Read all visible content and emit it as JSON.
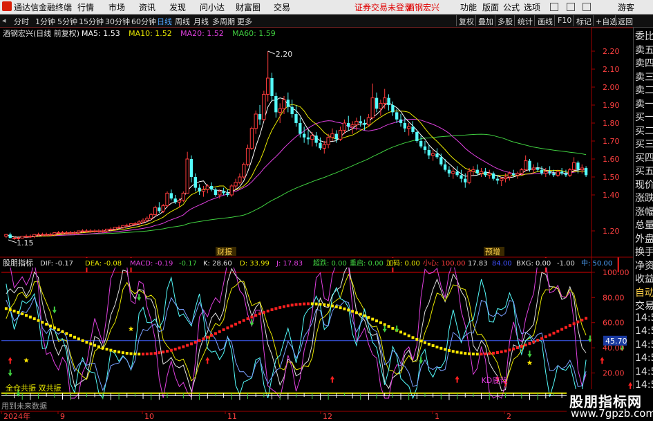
{
  "titlebar": {
    "app_name": "通达信金融终端",
    "menus": [
      "行情",
      "市场",
      "资讯",
      "发现",
      "问小达",
      "财富圈",
      "交易"
    ],
    "warning": "证券交易未登录",
    "stock_tag": "酒钢宏兴",
    "right_menus": [
      "功能",
      "版面",
      "公式",
      "选项"
    ],
    "guest": "游客"
  },
  "toolbar": {
    "periods": [
      "分时",
      "1分钟",
      "5分钟",
      "15分钟",
      "30分钟",
      "60分钟",
      "日线",
      "周线",
      "月线",
      "多周期",
      "更多"
    ],
    "active_period": "日线",
    "right_buttons": [
      "复权",
      "叠加",
      "多股",
      "统计",
      "画线",
      "F10",
      "标记",
      "+自选",
      "返回"
    ]
  },
  "right_panel": {
    "items": [
      "委比",
      "卖五",
      "卖四",
      "卖三",
      "卖二",
      "卖一",
      "买一",
      "买二",
      "买三",
      "买四",
      "买五",
      "现价",
      "涨跌",
      "涨幅",
      "总量",
      "外盘",
      "换手",
      "净资",
      "收益",
      "自动",
      "交易",
      "14:5",
      "14:5",
      "14:5",
      "14:5",
      "14:5",
      "14:5",
      "14:5",
      "14:5"
    ]
  },
  "watermark": {
    "name": "股朋指标网",
    "url": "www.7gpzb.com"
  },
  "chart_data": [
    {
      "type": "candlestick",
      "stock": "酒钢宏兴(日线 前复权)",
      "legend": [
        {
          "name": "MA5",
          "value": "1.53",
          "color": "#ffffff"
        },
        {
          "name": "MA10",
          "value": "1.52",
          "color": "#e8e800"
        },
        {
          "name": "MA20",
          "value": "1.52",
          "color": "#e040e0"
        },
        {
          "name": "MA60",
          "value": "1.59",
          "color": "#40d040"
        }
      ],
      "ylim": [
        1.1,
        2.3
      ],
      "y_ticks": [
        "2.20",
        "2.10",
        "2.00",
        "1.90",
        "1.80",
        "1.70",
        "1.60",
        "1.50",
        "1.40",
        "1.20"
      ],
      "x_labels": [
        "2024年",
        "9",
        "10",
        "11",
        "12",
        "1",
        "2"
      ],
      "annotations": [
        "2.20",
        "1.15",
        "财报",
        "预增"
      ],
      "colors": {
        "up": "#ff3c3c",
        "down": "#54fcfc",
        "ma5": "#ffffff",
        "ma10": "#e8e800",
        "ma20": "#e040e0",
        "ma60": "#40d040"
      },
      "candles": [
        [
          1.17,
          1.18,
          1.16,
          1.18
        ],
        [
          1.18,
          1.19,
          1.16,
          1.16
        ],
        [
          1.16,
          1.17,
          1.15,
          1.16
        ],
        [
          1.16,
          1.17,
          1.15,
          1.16
        ],
        [
          1.16,
          1.17,
          1.16,
          1.17
        ],
        [
          1.17,
          1.18,
          1.16,
          1.17
        ],
        [
          1.17,
          1.18,
          1.16,
          1.17
        ],
        [
          1.17,
          1.18,
          1.16,
          1.18
        ],
        [
          1.18,
          1.19,
          1.17,
          1.18
        ],
        [
          1.18,
          1.19,
          1.17,
          1.18
        ],
        [
          1.18,
          1.19,
          1.17,
          1.18
        ],
        [
          1.18,
          1.19,
          1.17,
          1.18
        ],
        [
          1.18,
          1.19,
          1.17,
          1.19
        ],
        [
          1.19,
          1.2,
          1.18,
          1.19
        ],
        [
          1.19,
          1.2,
          1.18,
          1.19
        ],
        [
          1.19,
          1.2,
          1.18,
          1.19
        ],
        [
          1.19,
          1.2,
          1.18,
          1.19
        ],
        [
          1.19,
          1.2,
          1.18,
          1.19
        ],
        [
          1.19,
          1.2,
          1.18,
          1.2
        ],
        [
          1.2,
          1.21,
          1.19,
          1.2
        ],
        [
          1.2,
          1.21,
          1.19,
          1.2
        ],
        [
          1.2,
          1.21,
          1.19,
          1.2
        ],
        [
          1.2,
          1.21,
          1.19,
          1.2
        ],
        [
          1.2,
          1.21,
          1.19,
          1.2
        ],
        [
          1.2,
          1.21,
          1.19,
          1.2
        ],
        [
          1.2,
          1.21,
          1.19,
          1.21
        ],
        [
          1.21,
          1.22,
          1.2,
          1.21
        ],
        [
          1.21,
          1.22,
          1.2,
          1.22
        ],
        [
          1.22,
          1.23,
          1.21,
          1.22
        ],
        [
          1.22,
          1.23,
          1.21,
          1.23
        ],
        [
          1.23,
          1.24,
          1.22,
          1.23
        ],
        [
          1.23,
          1.24,
          1.22,
          1.24
        ],
        [
          1.24,
          1.25,
          1.23,
          1.24
        ],
        [
          1.24,
          1.26,
          1.23,
          1.25
        ],
        [
          1.25,
          1.27,
          1.24,
          1.26
        ],
        [
          1.26,
          1.28,
          1.25,
          1.27
        ],
        [
          1.27,
          1.3,
          1.26,
          1.29
        ],
        [
          1.29,
          1.34,
          1.28,
          1.33
        ],
        [
          1.33,
          1.36,
          1.3,
          1.31
        ],
        [
          1.31,
          1.35,
          1.3,
          1.34
        ],
        [
          1.34,
          1.42,
          1.33,
          1.41
        ],
        [
          1.41,
          1.43,
          1.37,
          1.38
        ],
        [
          1.38,
          1.4,
          1.35,
          1.36
        ],
        [
          1.36,
          1.38,
          1.33,
          1.37
        ],
        [
          1.37,
          1.42,
          1.36,
          1.41
        ],
        [
          1.41,
          1.64,
          1.41,
          1.6
        ],
        [
          1.6,
          1.62,
          1.47,
          1.5
        ],
        [
          1.5,
          1.52,
          1.42,
          1.44
        ],
        [
          1.44,
          1.46,
          1.4,
          1.42
        ],
        [
          1.42,
          1.45,
          1.39,
          1.43
        ],
        [
          1.43,
          1.46,
          1.41,
          1.45
        ],
        [
          1.45,
          1.47,
          1.42,
          1.43
        ],
        [
          1.43,
          1.44,
          1.39,
          1.4
        ],
        [
          1.4,
          1.43,
          1.38,
          1.42
        ],
        [
          1.42,
          1.44,
          1.4,
          1.41
        ],
        [
          1.41,
          1.43,
          1.39,
          1.4
        ],
        [
          1.4,
          1.46,
          1.39,
          1.45
        ],
        [
          1.45,
          1.49,
          1.43,
          1.47
        ],
        [
          1.47,
          1.52,
          1.46,
          1.5
        ],
        [
          1.5,
          1.58,
          1.49,
          1.57
        ],
        [
          1.57,
          1.68,
          1.56,
          1.66
        ],
        [
          1.66,
          1.78,
          1.65,
          1.77
        ],
        [
          1.77,
          1.87,
          1.74,
          1.85
        ],
        [
          1.85,
          1.9,
          1.79,
          1.82
        ],
        [
          1.82,
          1.98,
          1.81,
          1.96
        ],
        [
          1.96,
          2.2,
          1.92,
          2.05
        ],
        [
          2.05,
          2.08,
          1.92,
          1.95
        ],
        [
          1.95,
          1.97,
          1.83,
          1.86
        ],
        [
          1.86,
          1.91,
          1.8,
          1.88
        ],
        [
          1.88,
          1.95,
          1.85,
          1.93
        ],
        [
          1.93,
          1.97,
          1.86,
          1.89
        ],
        [
          1.89,
          1.93,
          1.83,
          1.85
        ],
        [
          1.85,
          1.9,
          1.78,
          1.8
        ],
        [
          1.8,
          1.83,
          1.72,
          1.74
        ],
        [
          1.74,
          1.78,
          1.69,
          1.72
        ],
        [
          1.72,
          1.76,
          1.68,
          1.71
        ],
        [
          1.71,
          1.75,
          1.67,
          1.73
        ],
        [
          1.73,
          1.75,
          1.67,
          1.69
        ],
        [
          1.69,
          1.72,
          1.65,
          1.66
        ],
        [
          1.66,
          1.7,
          1.63,
          1.68
        ],
        [
          1.68,
          1.74,
          1.66,
          1.72
        ],
        [
          1.72,
          1.77,
          1.7,
          1.74
        ],
        [
          1.74,
          1.76,
          1.69,
          1.71
        ],
        [
          1.71,
          1.78,
          1.7,
          1.76
        ],
        [
          1.76,
          1.82,
          1.74,
          1.8
        ],
        [
          1.8,
          1.84,
          1.76,
          1.78
        ],
        [
          1.78,
          1.81,
          1.74,
          1.79
        ],
        [
          1.79,
          1.83,
          1.76,
          1.81
        ],
        [
          1.81,
          1.84,
          1.78,
          1.8
        ],
        [
          1.8,
          1.82,
          1.76,
          1.79
        ],
        [
          1.79,
          1.85,
          1.78,
          1.83
        ],
        [
          1.83,
          2.02,
          1.82,
          1.94
        ],
        [
          1.94,
          1.97,
          1.86,
          1.88
        ],
        [
          1.88,
          1.93,
          1.84,
          1.91
        ],
        [
          1.91,
          1.99,
          1.88,
          1.94
        ],
        [
          1.94,
          1.96,
          1.87,
          1.9
        ],
        [
          1.9,
          1.92,
          1.84,
          1.86
        ],
        [
          1.86,
          1.88,
          1.8,
          1.82
        ],
        [
          1.82,
          1.85,
          1.78,
          1.8
        ],
        [
          1.8,
          1.83,
          1.75,
          1.77
        ],
        [
          1.77,
          1.8,
          1.73,
          1.78
        ],
        [
          1.78,
          1.81,
          1.74,
          1.75
        ],
        [
          1.75,
          1.76,
          1.69,
          1.7
        ],
        [
          1.7,
          1.73,
          1.66,
          1.67
        ],
        [
          1.67,
          1.7,
          1.63,
          1.65
        ],
        [
          1.65,
          1.68,
          1.6,
          1.62
        ],
        [
          1.62,
          1.65,
          1.59,
          1.63
        ],
        [
          1.63,
          1.66,
          1.6,
          1.61
        ],
        [
          1.61,
          1.63,
          1.56,
          1.57
        ],
        [
          1.57,
          1.6,
          1.53,
          1.54
        ],
        [
          1.54,
          1.56,
          1.5,
          1.52
        ],
        [
          1.52,
          1.55,
          1.49,
          1.53
        ],
        [
          1.53,
          1.56,
          1.5,
          1.51
        ],
        [
          1.51,
          1.54,
          1.47,
          1.49
        ],
        [
          1.49,
          1.52,
          1.44,
          1.47
        ],
        [
          1.47,
          1.55,
          1.46,
          1.53
        ],
        [
          1.53,
          1.56,
          1.51,
          1.54
        ],
        [
          1.54,
          1.57,
          1.51,
          1.52
        ],
        [
          1.52,
          1.55,
          1.5,
          1.53
        ],
        [
          1.53,
          1.55,
          1.5,
          1.51
        ],
        [
          1.51,
          1.54,
          1.49,
          1.52
        ],
        [
          1.52,
          1.53,
          1.48,
          1.49
        ],
        [
          1.49,
          1.51,
          1.46,
          1.48
        ],
        [
          1.48,
          1.5,
          1.45,
          1.49
        ],
        [
          1.49,
          1.52,
          1.47,
          1.5
        ],
        [
          1.5,
          1.53,
          1.48,
          1.52
        ],
        [
          1.52,
          1.54,
          1.5,
          1.51
        ],
        [
          1.51,
          1.53,
          1.49,
          1.52
        ],
        [
          1.52,
          1.55,
          1.51,
          1.54
        ],
        [
          1.54,
          1.62,
          1.53,
          1.59
        ],
        [
          1.59,
          1.6,
          1.53,
          1.54
        ],
        [
          1.54,
          1.57,
          1.52,
          1.55
        ],
        [
          1.55,
          1.58,
          1.53,
          1.54
        ],
        [
          1.54,
          1.56,
          1.51,
          1.52
        ],
        [
          1.52,
          1.55,
          1.5,
          1.53
        ],
        [
          1.53,
          1.56,
          1.51,
          1.52
        ],
        [
          1.52,
          1.54,
          1.5,
          1.51
        ],
        [
          1.51,
          1.54,
          1.5,
          1.53
        ],
        [
          1.53,
          1.55,
          1.51,
          1.52
        ],
        [
          1.52,
          1.54,
          1.5,
          1.51
        ],
        [
          1.51,
          1.55,
          1.5,
          1.54
        ],
        [
          1.54,
          1.61,
          1.53,
          1.58
        ],
        [
          1.58,
          1.59,
          1.52,
          1.54
        ],
        [
          1.54,
          1.57,
          1.52,
          1.55
        ],
        [
          1.55,
          1.56,
          1.5,
          1.51
        ]
      ]
    },
    {
      "type": "line",
      "indicator": "股朋指标",
      "legend": [
        {
          "name": "DIF",
          "value": "-0.17",
          "color": "#e0e0e0"
        },
        {
          "name": "DEA",
          "value": "-0.08",
          "color": "#e8e800"
        },
        {
          "name": "MACD",
          "value": "-0.19",
          "color": "#e040e0"
        },
        {
          "name": "",
          "value": "-0.17",
          "color": "#40d040"
        },
        {
          "name": "K",
          "value": "28.60",
          "color": "#e0e0e0"
        },
        {
          "name": "D",
          "value": "33.99",
          "color": "#e8e800"
        },
        {
          "name": "J",
          "value": "17.83",
          "color": "#e040e0"
        },
        {
          "name": "超跌",
          "value": "0.00",
          "color": "#40d040"
        },
        {
          "name": "重启",
          "value": "0.00",
          "color": "#40d040"
        },
        {
          "name": "加码",
          "value": "0.00",
          "color": "#e8e800"
        },
        {
          "name": "小心",
          "value": "100.00",
          "color": "#ff3c3c"
        },
        {
          "name": "",
          "value": "17.83",
          "color": "#e0e0e0"
        },
        {
          "name": "",
          "value": "84.00",
          "color": "#4050ff"
        },
        {
          "name": "BXG",
          "value": "0.00",
          "color": "#e0e0e0"
        },
        {
          "name": "",
          "value": "-1.00",
          "color": "#e0e0e0"
        },
        {
          "name": "中",
          "value": "50.00",
          "color": "#4fa3ff"
        }
      ],
      "ylim": [
        0,
        112
      ],
      "y_ticks": [
        "100.00",
        "80.00",
        "60.00",
        "40.00",
        "20.00"
      ],
      "current_label": "45.70",
      "annotations": [
        "KD底背",
        "全仓共振 双共振"
      ]
    }
  ],
  "footer_hint": "用到未来数据"
}
